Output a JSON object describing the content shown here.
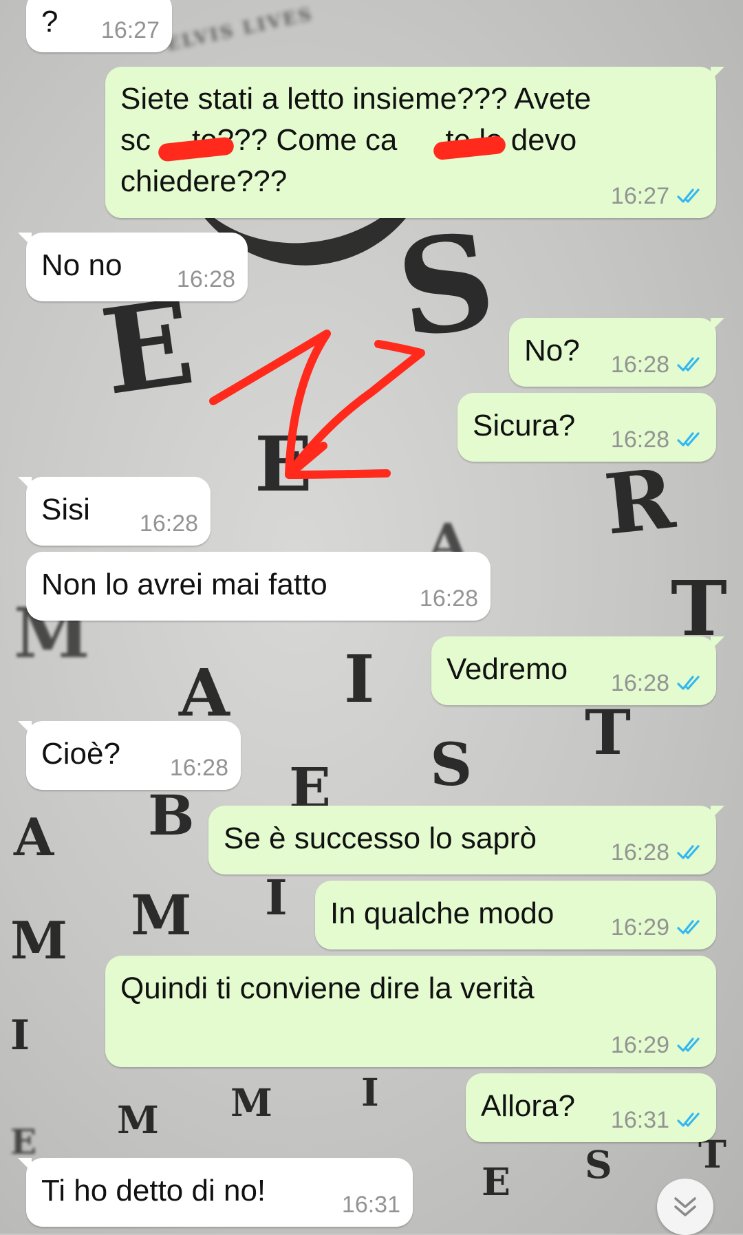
{
  "wallpaper": {
    "letters": [
      "E",
      "S",
      "E",
      "R",
      "T",
      "M",
      "A",
      "I",
      "A",
      "T",
      "E",
      "S",
      "A",
      "B",
      "M",
      "M",
      "I",
      "I",
      "M",
      "M",
      "I",
      "E",
      "E",
      "S",
      "T"
    ],
    "small_text": "ELVIS LIVES"
  },
  "messages": [
    {
      "dir": "in",
      "text": "?",
      "time": "16:27"
    },
    {
      "dir": "out",
      "line1": "Siete stati a letto insieme??? Avete",
      "line2a": "sc",
      "line2b": "to??? Come ca",
      "line2c": "te lo devo",
      "line3": "chiedere???",
      "time": "16:27",
      "status": "read"
    },
    {
      "dir": "in",
      "text": "No no",
      "time": "16:28"
    },
    {
      "dir": "out",
      "text": "No?",
      "time": "16:28",
      "status": "read"
    },
    {
      "dir": "out",
      "text": "Sicura?",
      "time": "16:28",
      "status": "read"
    },
    {
      "dir": "in",
      "text": "Sisi",
      "time": "16:28"
    },
    {
      "dir": "in",
      "text": "Non lo avrei mai fatto",
      "time": "16:28"
    },
    {
      "dir": "out",
      "text": "Vedremo",
      "time": "16:28",
      "status": "read"
    },
    {
      "dir": "in",
      "text": "Cioè?",
      "time": "16:28"
    },
    {
      "dir": "out",
      "text": "Se è successo lo saprò",
      "time": "16:28",
      "status": "read"
    },
    {
      "dir": "out",
      "text": "In qualche modo",
      "time": "16:29",
      "status": "read"
    },
    {
      "dir": "out",
      "text": "Quindi ti conviene dire la verità",
      "time": "16:29",
      "status": "read"
    },
    {
      "dir": "out",
      "text": "Allora?",
      "time": "16:31",
      "status": "read"
    },
    {
      "dir": "in",
      "text": "Ti ho detto di no!",
      "time": "16:31"
    }
  ],
  "colors": {
    "incoming_bubble": "#ffffff",
    "outgoing_bubble": "#e3fbcf",
    "read_ticks": "#34b7f1",
    "timestamp": "#939393",
    "annotation": "#ff2a1c"
  },
  "icons": {
    "read_receipt": "double-check-icon",
    "scroll_down": "double-chevron-down-icon"
  }
}
